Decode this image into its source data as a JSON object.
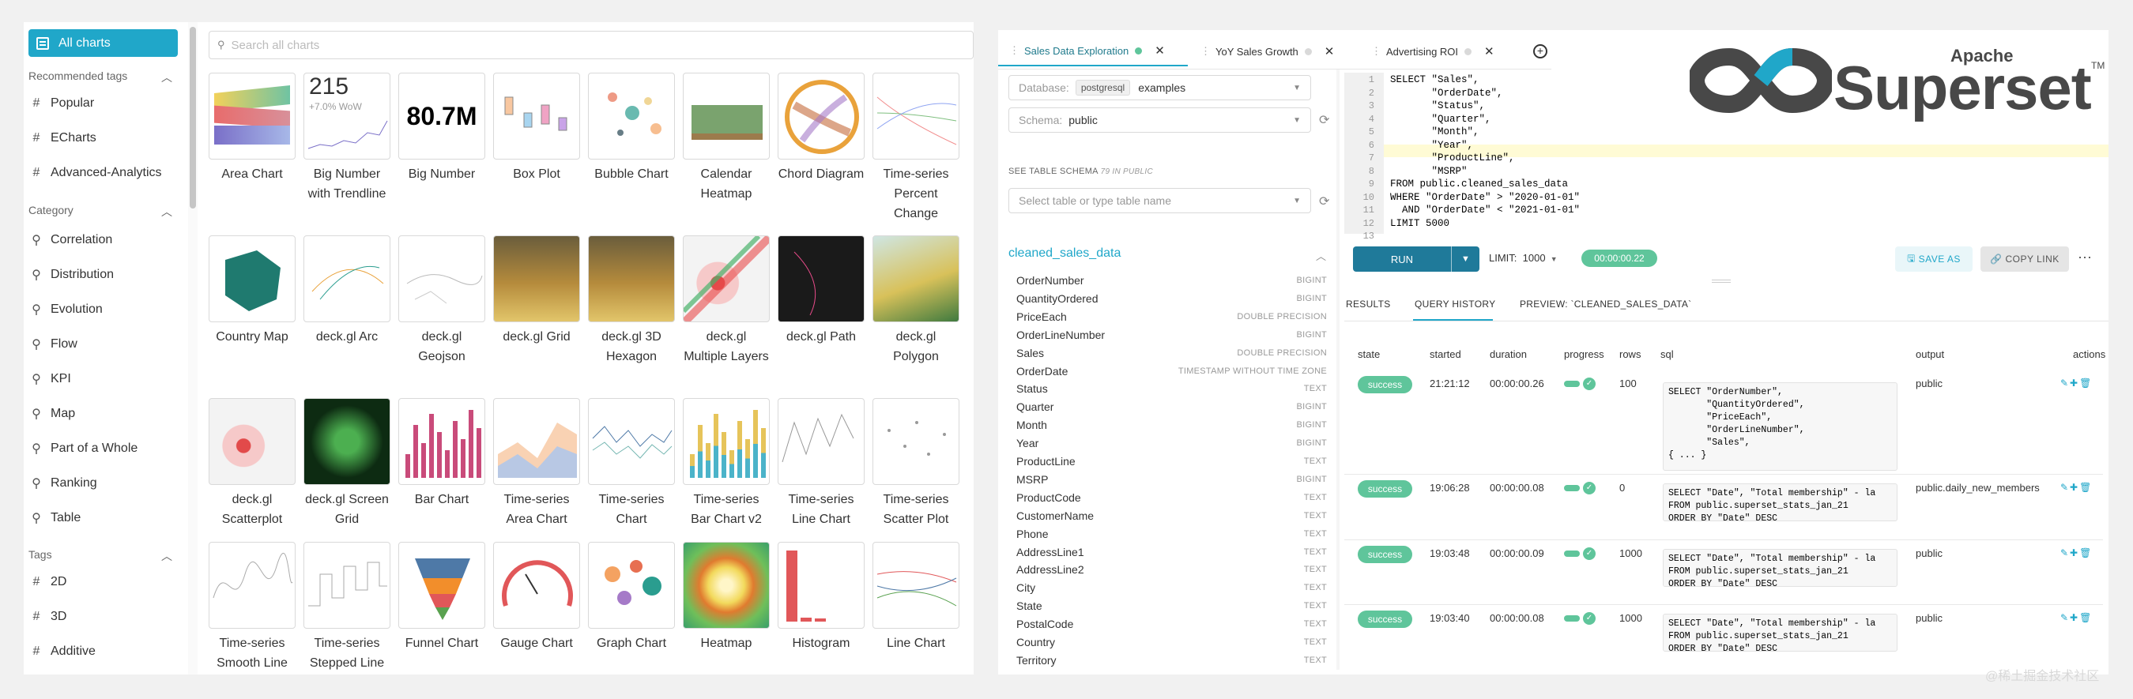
{
  "gallery": {
    "all_charts": "All charts",
    "search_placeholder": "Search all charts",
    "recommended_tags_title": "Recommended tags",
    "recommended_tags": [
      "Popular",
      "ECharts",
      "Advanced-Analytics"
    ],
    "category_title": "Category",
    "categories": [
      "Correlation",
      "Distribution",
      "Evolution",
      "Flow",
      "KPI",
      "Map",
      "Part of a Whole",
      "Ranking",
      "Table"
    ],
    "tags_title": "Tags",
    "tags": [
      "2D",
      "3D",
      "Additive"
    ],
    "tiles": [
      {
        "label": "Area Chart"
      },
      {
        "label": "Big Number with Trendline"
      },
      {
        "label": "Big Number"
      },
      {
        "label": "Box Plot"
      },
      {
        "label": "Bubble Chart"
      },
      {
        "label": "Calendar Heatmap"
      },
      {
        "label": "Chord Diagram"
      },
      {
        "label": "Time-series Percent Change"
      },
      {
        "label": "Country Map"
      },
      {
        "label": "deck.gl Arc"
      },
      {
        "label": "deck.gl Geojson"
      },
      {
        "label": "deck.gl Grid"
      },
      {
        "label": "deck.gl 3D Hexagon"
      },
      {
        "label": "deck.gl Multiple Layers"
      },
      {
        "label": "deck.gl Path"
      },
      {
        "label": "deck.gl Polygon"
      },
      {
        "label": "deck.gl Scatterplot"
      },
      {
        "label": "deck.gl Screen Grid"
      },
      {
        "label": "Bar Chart"
      },
      {
        "label": "Time-series Area Chart"
      },
      {
        "label": "Time-series Chart"
      },
      {
        "label": "Time-series Bar Chart v2"
      },
      {
        "label": "Time-series Line Chart"
      },
      {
        "label": "Time-series Scatter Plot"
      },
      {
        "label": "Time-series Smooth Line"
      },
      {
        "label": "Time-series Stepped Line"
      },
      {
        "label": "Funnel Chart"
      },
      {
        "label": "Gauge Chart"
      },
      {
        "label": "Graph Chart"
      },
      {
        "label": "Heatmap"
      },
      {
        "label": "Histogram"
      },
      {
        "label": "Line Chart"
      }
    ],
    "thumb_big_number_value": "215",
    "thumb_big_number_sub": "+7.0% WoW",
    "thumb_big_number_value2": "80.7M"
  },
  "sqllab": {
    "tabs": [
      {
        "label": "Sales Data Exploration",
        "status_color": "#5fc59b"
      },
      {
        "label": "YoY Sales Growth",
        "status_color": "#d9d9d9"
      },
      {
        "label": "Advertising ROI",
        "status_color": "#d9d9d9"
      }
    ],
    "database_label": "Database:",
    "database_engine": "postgresql",
    "database_value": "examples",
    "schema_label": "Schema:",
    "schema_value": "public",
    "see_schema_label": "SEE TABLE SCHEMA",
    "schema_count": "79 IN PUBLIC",
    "table_placeholder": "Select table or type table name",
    "table_name": "cleaned_sales_data",
    "columns": [
      {
        "name": "OrderNumber",
        "type": "BIGINT"
      },
      {
        "name": "QuantityOrdered",
        "type": "BIGINT"
      },
      {
        "name": "PriceEach",
        "type": "DOUBLE PRECISION"
      },
      {
        "name": "OrderLineNumber",
        "type": "BIGINT"
      },
      {
        "name": "Sales",
        "type": "DOUBLE PRECISION"
      },
      {
        "name": "OrderDate",
        "type": "TIMESTAMP WITHOUT TIME ZONE"
      },
      {
        "name": "Status",
        "type": "TEXT"
      },
      {
        "name": "Quarter",
        "type": "BIGINT"
      },
      {
        "name": "Month",
        "type": "BIGINT"
      },
      {
        "name": "Year",
        "type": "BIGINT"
      },
      {
        "name": "ProductLine",
        "type": "TEXT"
      },
      {
        "name": "MSRP",
        "type": "BIGINT"
      },
      {
        "name": "ProductCode",
        "type": "TEXT"
      },
      {
        "name": "CustomerName",
        "type": "TEXT"
      },
      {
        "name": "Phone",
        "type": "TEXT"
      },
      {
        "name": "AddressLine1",
        "type": "TEXT"
      },
      {
        "name": "AddressLine2",
        "type": "TEXT"
      },
      {
        "name": "City",
        "type": "TEXT"
      },
      {
        "name": "State",
        "type": "TEXT"
      },
      {
        "name": "PostalCode",
        "type": "TEXT"
      },
      {
        "name": "Country",
        "type": "TEXT"
      },
      {
        "name": "Territory",
        "type": "TEXT"
      }
    ],
    "editor_lines": [
      "SELECT \"Sales\",",
      "       \"OrderDate\",",
      "       \"Status\",",
      "       \"Quarter\",",
      "       \"Month\",",
      "       \"Year\",",
      "       \"ProductLine\",",
      "       \"MSRP\"",
      "FROM public.cleaned_sales_data",
      "WHERE \"OrderDate\" > \"2020-01-01\"",
      "  AND \"OrderDate\" < \"2021-01-01\"",
      "LIMIT 5000"
    ],
    "run_label": "RUN",
    "limit_label": "LIMIT:",
    "limit_value": "1000",
    "timer": "00:00:00.22",
    "save_as": "SAVE AS",
    "copy_link": "COPY LINK",
    "result_tabs": [
      "RESULTS",
      "QUERY HISTORY",
      "PREVIEW: `CLEANED_SALES_DATA`"
    ],
    "history_headers": [
      "state",
      "started",
      "duration",
      "progress",
      "rows",
      "sql",
      "output",
      "actions"
    ],
    "history": [
      {
        "state": "success",
        "started": "21:21:12",
        "duration": "00:00:00.26",
        "rows": "100",
        "sql": "SELECT \"OrderNumber\",\n       \"QuantityOrdered\",\n       \"PriceEach\",\n       \"OrderLineNumber\",\n       \"Sales\",\n{ ... }",
        "output": "public"
      },
      {
        "state": "success",
        "started": "19:06:28",
        "duration": "00:00:00.08",
        "rows": "0",
        "sql": "SELECT \"Date\", \"Total membership\" - la\nFROM public.superset_stats_jan_21\nORDER BY \"Date\" DESC",
        "output": "public.daily_new_members"
      },
      {
        "state": "success",
        "started": "19:03:48",
        "duration": "00:00:00.09",
        "rows": "1000",
        "sql": "SELECT \"Date\", \"Total membership\" - la\nFROM public.superset_stats_jan_21\nORDER BY \"Date\" DESC",
        "output": "public"
      },
      {
        "state": "success",
        "started": "19:03:40",
        "duration": "00:00:00.08",
        "rows": "1000",
        "sql": "SELECT \"Date\", \"Total membership\" - la\nFROM public.superset_stats_jan_21\nORDER BY \"Date\" DESC",
        "output": "public"
      }
    ]
  },
  "logo": {
    "apache": "Apache",
    "word": "Superset",
    "tm": "TM"
  },
  "watermark": "@稀土掘金技术社区",
  "colors": {
    "accent": "#20a7c9",
    "success": "#5fc59b",
    "run_button": "#1f7a9a"
  }
}
